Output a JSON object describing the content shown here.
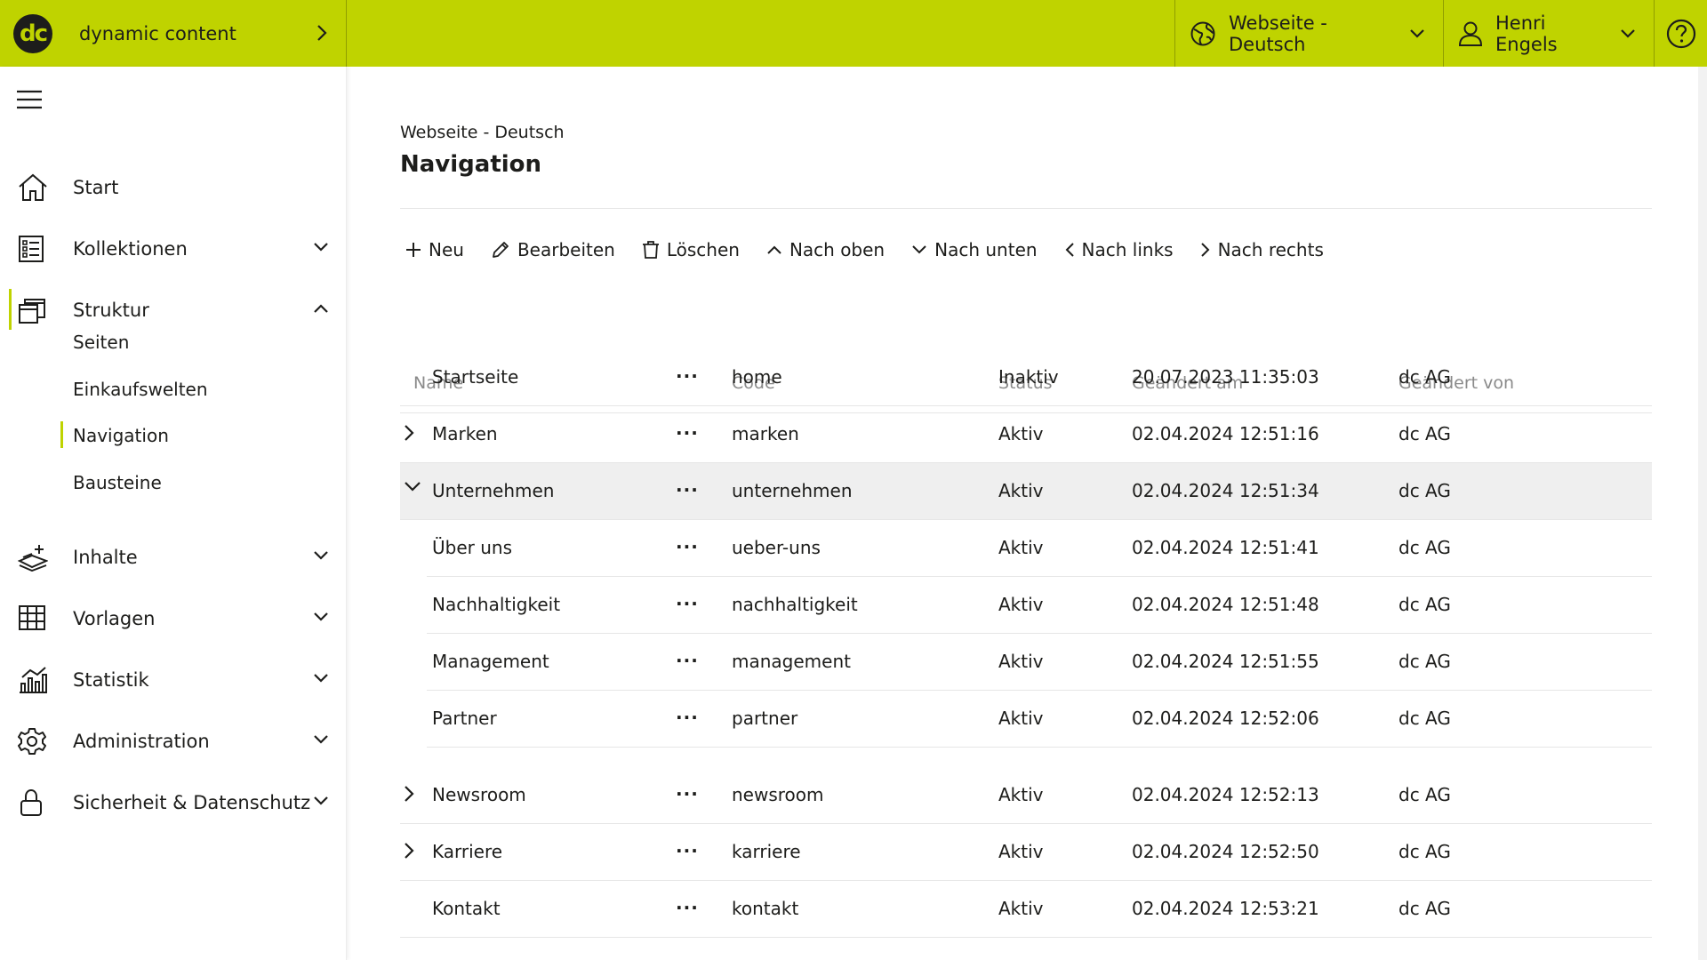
{
  "app": {
    "brand_logo": "dc",
    "brand_name": "dynamic content",
    "site_selector": "Webseite - Deutsch",
    "user_name": "Henri Engels",
    "accent_color": "#bfd300"
  },
  "sidebar": {
    "items": [
      {
        "label": "Start",
        "icon": "home-icon"
      },
      {
        "label": "Kollektionen",
        "icon": "list-icon"
      },
      {
        "label": "Struktur",
        "icon": "windows-icon"
      },
      {
        "label": "Inhalte",
        "icon": "content-icon"
      },
      {
        "label": "Vorlagen",
        "icon": "grid-icon"
      },
      {
        "label": "Statistik",
        "icon": "chart-icon"
      },
      {
        "label": "Administration",
        "icon": "gear-icon"
      },
      {
        "label": "Sicherheit & Datenschutz",
        "icon": "lock-icon"
      }
    ],
    "struktur_sub": [
      "Seiten",
      "Einkaufswelten",
      "Navigation",
      "Bausteine"
    ]
  },
  "main": {
    "breadcrumb": "Webseite - Deutsch",
    "title": "Navigation",
    "toolbar": {
      "new": "Neu",
      "edit": "Bearbeiten",
      "delete": "Löschen",
      "up": "Nach oben",
      "down": "Nach unten",
      "left": "Nach links",
      "right": "Nach rechts"
    },
    "table": {
      "columns": [
        "Name",
        "Code",
        "Status",
        "Geändert am",
        "Geändert von"
      ],
      "more_label": "···",
      "rows": [
        {
          "name": "Startseite",
          "code": "home",
          "status": "Inaktiv",
          "changed_at": "20.07.2023 11:35:03",
          "changed_by": "dc AG"
        },
        {
          "name": "Marken",
          "code": "marken",
          "status": "Aktiv",
          "changed_at": "02.04.2024 12:51:16",
          "changed_by": "dc AG"
        },
        {
          "name": "Unternehmen",
          "code": "unternehmen",
          "status": "Aktiv",
          "changed_at": "02.04.2024 12:51:34",
          "changed_by": "dc AG"
        },
        {
          "name": "Über uns",
          "code": "ueber-uns",
          "status": "Aktiv",
          "changed_at": "02.04.2024 12:51:41",
          "changed_by": "dc AG"
        },
        {
          "name": "Nachhaltigkeit",
          "code": "nachhaltigkeit",
          "status": "Aktiv",
          "changed_at": "02.04.2024 12:51:48",
          "changed_by": "dc AG"
        },
        {
          "name": "Management",
          "code": "management",
          "status": "Aktiv",
          "changed_at": "02.04.2024 12:51:55",
          "changed_by": "dc AG"
        },
        {
          "name": "Partner",
          "code": "partner",
          "status": "Aktiv",
          "changed_at": "02.04.2024 12:52:06",
          "changed_by": "dc AG"
        },
        {
          "name": "Newsroom",
          "code": "newsroom",
          "status": "Aktiv",
          "changed_at": "02.04.2024 12:52:13",
          "changed_by": "dc AG"
        },
        {
          "name": "Karriere",
          "code": "karriere",
          "status": "Aktiv",
          "changed_at": "02.04.2024 12:52:50",
          "changed_by": "dc AG"
        },
        {
          "name": "Kontakt",
          "code": "kontakt",
          "status": "Aktiv",
          "changed_at": "02.04.2024 12:53:21",
          "changed_by": "dc AG"
        }
      ]
    }
  }
}
